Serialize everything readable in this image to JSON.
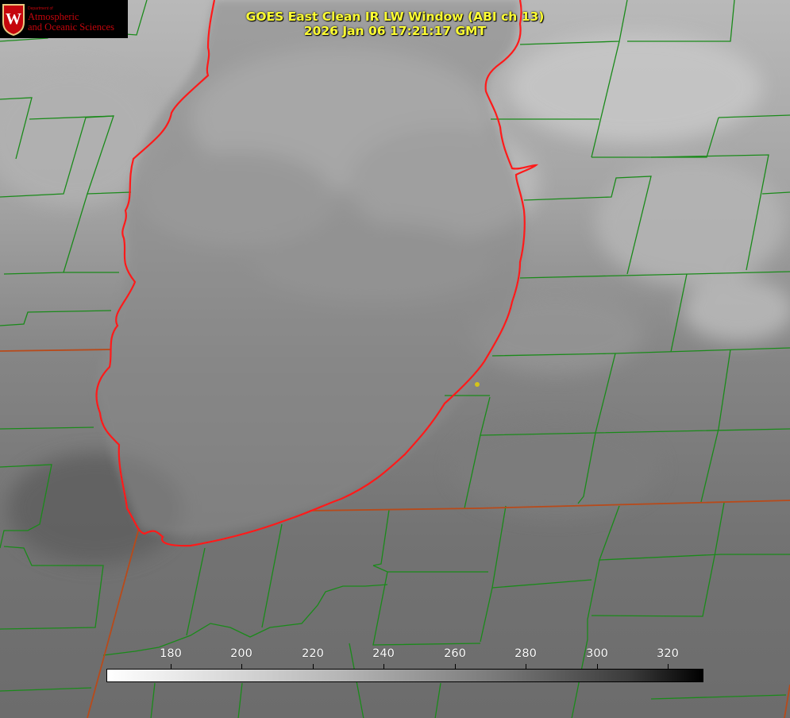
{
  "header": {
    "title_line1": "GOES East Clean IR LW Window (ABI ch 13)",
    "title_line2": "2026 Jan 06 17:21:17 GMT"
  },
  "logo": {
    "department": "Department of",
    "line1": "Atmospheric",
    "line2": "and Oceanic Sciences",
    "seal_letter": "W"
  },
  "colorbar": {
    "ticks": [
      "180",
      "200",
      "220",
      "240",
      "260",
      "280",
      "300",
      "320"
    ],
    "range": [
      162,
      330
    ],
    "colormap": "white-to-black"
  },
  "map": {
    "lake_outline_color": "#ff1a1a",
    "county_border_color": "#1a8a1a",
    "state_border_color": "#b84a1a",
    "marker_color": "#d4c418"
  }
}
